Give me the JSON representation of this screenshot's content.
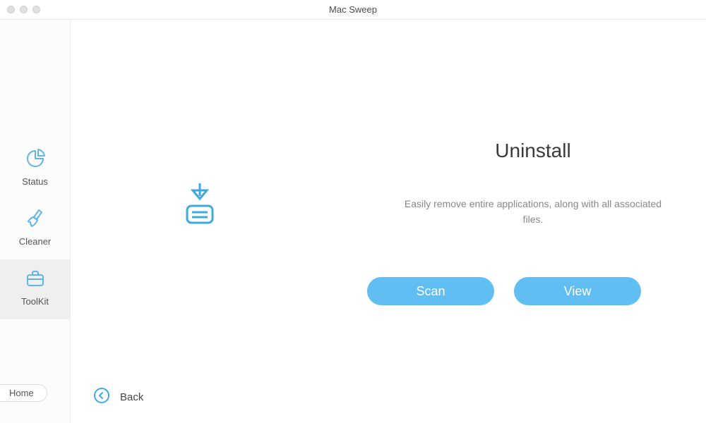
{
  "window": {
    "title": "Mac Sweep"
  },
  "sidebar": {
    "items": [
      {
        "label": "Status"
      },
      {
        "label": "Cleaner"
      },
      {
        "label": "ToolKit"
      }
    ],
    "home_label": "Home"
  },
  "main": {
    "title": "Uninstall",
    "description": "Easily remove entire applications, along with all associated files.",
    "scan_label": "Scan",
    "view_label": "View",
    "back_label": "Back"
  },
  "colors": {
    "accent": "#60bef2"
  }
}
